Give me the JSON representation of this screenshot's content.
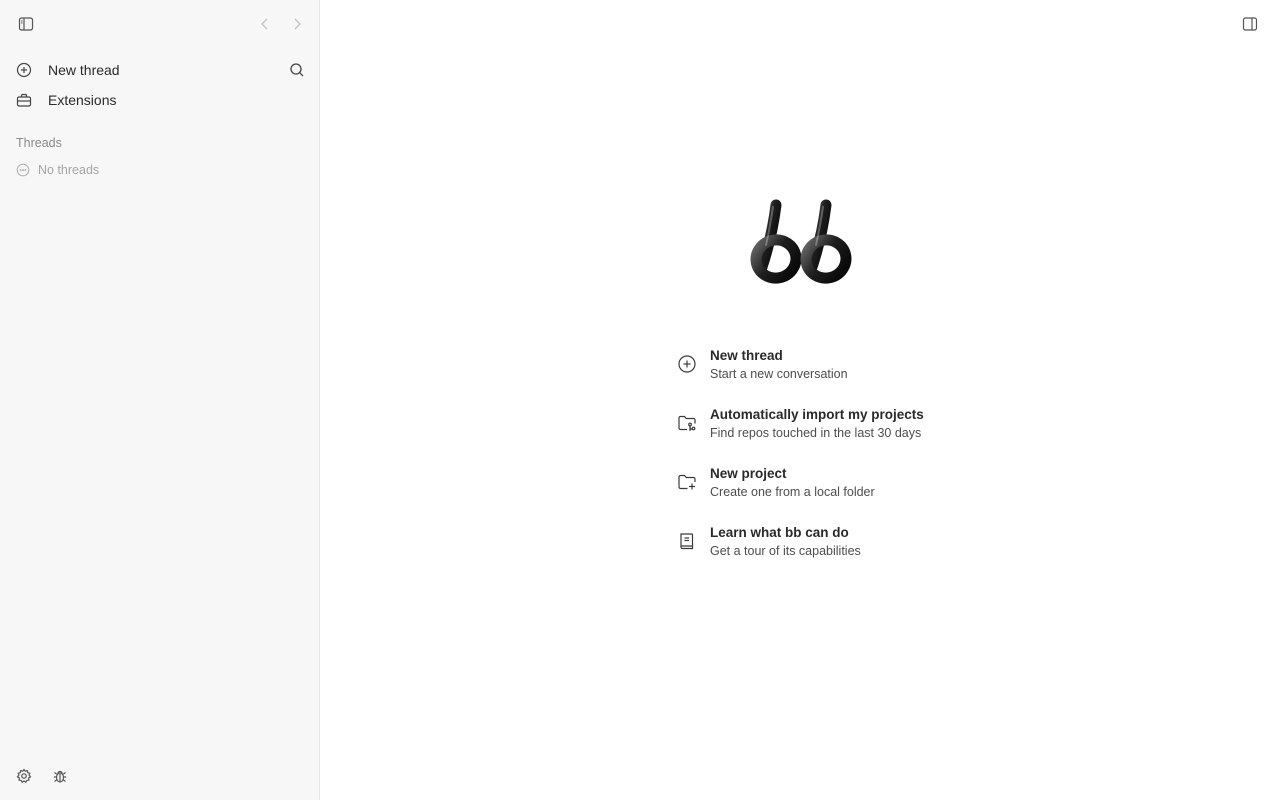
{
  "sidebar": {
    "toggle_icon": "sidebar-toggle-icon",
    "back_icon": "chevron-left-icon",
    "forward_icon": "chevron-right-icon",
    "items": [
      {
        "label": "New thread",
        "icon": "plus-circle-icon"
      },
      {
        "label": "Extensions",
        "icon": "toolbox-icon"
      }
    ],
    "search_icon": "search-icon",
    "threads_section_label": "Threads",
    "threads_empty_label": "No threads",
    "settings_icon": "gear-icon",
    "debug_icon": "bug-icon"
  },
  "main": {
    "panel_toggle_icon": "right-panel-toggle-icon",
    "logo_icon": "bb-logo-icon",
    "actions": [
      {
        "title": "New thread",
        "subtitle": "Start a new conversation",
        "icon": "plus-circle-icon"
      },
      {
        "title": "Automatically import my projects",
        "subtitle": "Find repos touched in the last 30 days",
        "icon": "folder-git-icon"
      },
      {
        "title": "New project",
        "subtitle": "Create one from a local folder",
        "icon": "folder-plus-icon"
      },
      {
        "title": "Learn what bb can do",
        "subtitle": "Get a tour of its capabilities",
        "icon": "book-icon"
      }
    ]
  }
}
